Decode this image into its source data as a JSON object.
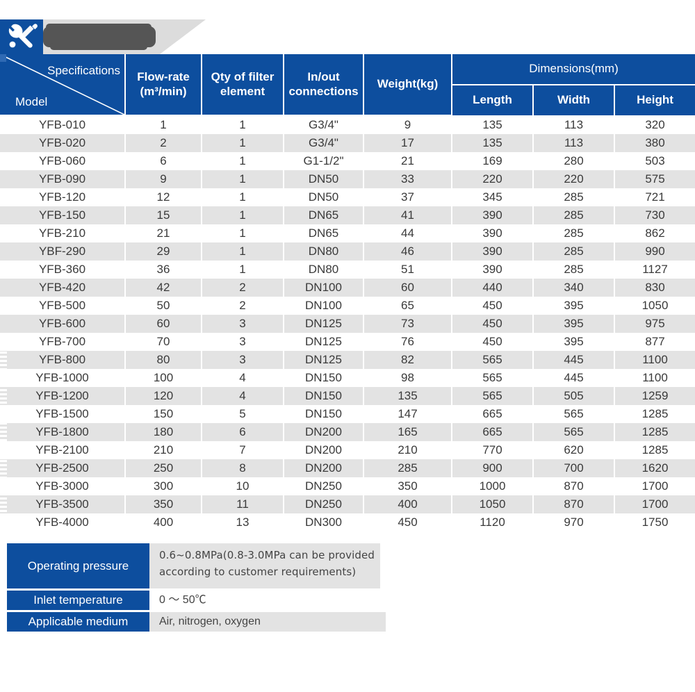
{
  "banner": {
    "icon": "wrench-screwdriver-icon",
    "title_redacted": true,
    "title": ""
  },
  "table": {
    "corner": {
      "top_label": "Specifications",
      "bottom_label": "Model"
    },
    "headers": {
      "flow_rate_line1": "Flow-rate",
      "flow_rate_line2": "(m³/min)",
      "qty_line1": "Qty of filter",
      "qty_line2": "element",
      "inout_line1": "In/out",
      "inout_line2": "connections",
      "weight": "Weight(kg)",
      "dimensions": "Dimensions(mm)",
      "length": "Length",
      "width": "Width",
      "height": "Height"
    },
    "rows": [
      {
        "model": "YFB-010",
        "flow": "1",
        "qty": "1",
        "conn": "G3/4\"",
        "weight": "9",
        "length": "135",
        "width": "113",
        "height": "320"
      },
      {
        "model": "YFB-020",
        "flow": "2",
        "qty": "1",
        "conn": "G3/4\"",
        "weight": "17",
        "length": "135",
        "width": "113",
        "height": "380"
      },
      {
        "model": "YFB-060",
        "flow": "6",
        "qty": "1",
        "conn": "G1-1/2\"",
        "weight": "21",
        "length": "169",
        "width": "280",
        "height": "503"
      },
      {
        "model": "YFB-090",
        "flow": "9",
        "qty": "1",
        "conn": "DN50",
        "weight": "33",
        "length": "220",
        "width": "220",
        "height": "575"
      },
      {
        "model": "YFB-120",
        "flow": "12",
        "qty": "1",
        "conn": "DN50",
        "weight": "37",
        "length": "345",
        "width": "285",
        "height": "721"
      },
      {
        "model": "YFB-150",
        "flow": "15",
        "qty": "1",
        "conn": "DN65",
        "weight": "41",
        "length": "390",
        "width": "285",
        "height": "730"
      },
      {
        "model": "YFB-210",
        "flow": "21",
        "qty": "1",
        "conn": "DN65",
        "weight": "44",
        "length": "390",
        "width": "285",
        "height": "862"
      },
      {
        "model": "YBF-290",
        "flow": "29",
        "qty": "1",
        "conn": "DN80",
        "weight": "46",
        "length": "390",
        "width": "285",
        "height": "990"
      },
      {
        "model": "YFB-360",
        "flow": "36",
        "qty": "1",
        "conn": "DN80",
        "weight": "51",
        "length": "390",
        "width": "285",
        "height": "1127"
      },
      {
        "model": "YFB-420",
        "flow": "42",
        "qty": "2",
        "conn": "DN100",
        "weight": "60",
        "length": "440",
        "width": "340",
        "height": "830"
      },
      {
        "model": "YFB-500",
        "flow": "50",
        "qty": "2",
        "conn": "DN100",
        "weight": "65",
        "length": "450",
        "width": "395",
        "height": "1050"
      },
      {
        "model": "YFB-600",
        "flow": "60",
        "qty": "3",
        "conn": "DN125",
        "weight": "73",
        "length": "450",
        "width": "395",
        "height": "975"
      },
      {
        "model": "YFB-700",
        "flow": "70",
        "qty": "3",
        "conn": "DN125",
        "weight": "76",
        "length": "450",
        "width": "395",
        "height": "877"
      },
      {
        "model": "YFB-800",
        "flow": "80",
        "qty": "3",
        "conn": "DN125",
        "weight": "82",
        "length": "565",
        "width": "445",
        "height": "1100"
      },
      {
        "model": "YFB-1000",
        "flow": "100",
        "qty": "4",
        "conn": "DN150",
        "weight": "98",
        "length": "565",
        "width": "445",
        "height": "1100"
      },
      {
        "model": "YFB-1200",
        "flow": "120",
        "qty": "4",
        "conn": "DN150",
        "weight": "135",
        "length": "565",
        "width": "505",
        "height": "1259"
      },
      {
        "model": "YFB-1500",
        "flow": "150",
        "qty": "5",
        "conn": "DN150",
        "weight": "147",
        "length": "665",
        "width": "565",
        "height": "1285"
      },
      {
        "model": "YFB-1800",
        "flow": "180",
        "qty": "6",
        "conn": "DN200",
        "weight": "165",
        "length": "665",
        "width": "565",
        "height": "1285"
      },
      {
        "model": "YFB-2100",
        "flow": "210",
        "qty": "7",
        "conn": "DN200",
        "weight": "210",
        "length": "770",
        "width": "620",
        "height": "1285"
      },
      {
        "model": "YFB-2500",
        "flow": "250",
        "qty": "8",
        "conn": "DN200",
        "weight": "285",
        "length": "900",
        "width": "700",
        "height": "1620"
      },
      {
        "model": "YFB-3000",
        "flow": "300",
        "qty": "10",
        "conn": "DN250",
        "weight": "350",
        "length": "1000",
        "width": "870",
        "height": "1700"
      },
      {
        "model": "YFB-3500",
        "flow": "350",
        "qty": "11",
        "conn": "DN250",
        "weight": "400",
        "length": "1050",
        "width": "870",
        "height": "1700"
      },
      {
        "model": "YFB-4000",
        "flow": "400",
        "qty": "13",
        "conn": "DN300",
        "weight": "450",
        "length": "1120",
        "width": "970",
        "height": "1750"
      }
    ]
  },
  "spec_panel": {
    "operating_pressure_label": "Operating pressure",
    "operating_pressure_value": "0.6~0.8MPa(0.8-3.0MPa can be provided according to customer requirements)",
    "inlet_temperature_label": "Inlet temperature",
    "inlet_temperature_value": "0 ～ 50℃",
    "applicable_medium_label": "Applicable medium",
    "applicable_medium_value": "Air, nitrogen, oxygen"
  },
  "colors": {
    "header_blue": "#0d4e9e",
    "alt_row_gray": "#e3e3e3",
    "banner_gray": "#dcdcdc",
    "text_gray": "#3a3a3a",
    "redaction_gray": "#555555"
  }
}
